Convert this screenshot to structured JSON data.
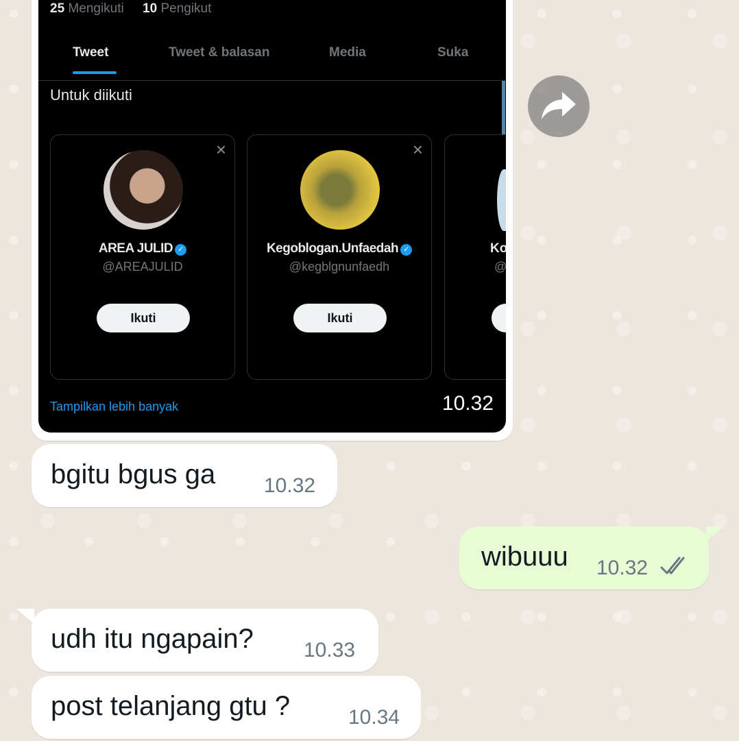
{
  "screenshot": {
    "stats": {
      "following_count": "25",
      "following_label": "Mengikuti",
      "followers_count": "10",
      "followers_label": "Pengikut"
    },
    "tabs": [
      {
        "label": "Tweet",
        "active": true
      },
      {
        "label": "Tweet & balasan",
        "active": false
      },
      {
        "label": "Media",
        "active": false
      },
      {
        "label": "Suka",
        "active": false
      }
    ],
    "section_title": "Untuk diikuti",
    "cards": [
      {
        "name": "AREA JULID",
        "handle": "@AREAJULID",
        "button": "Ikuti",
        "verified": true
      },
      {
        "name": "Kegoblogan.Unfaedah",
        "handle": "@kegblgnunfaedh",
        "button": "Ikuti",
        "verified": true
      },
      {
        "name": "Ko",
        "handle": "@"
      }
    ],
    "more_link": "Tampilkan lebih banyak",
    "verified_icon": "✓",
    "close_icon": "×"
  },
  "image_message": {
    "time": "10.32"
  },
  "messages": [
    {
      "direction": "in",
      "text": "bgitu bgus ga",
      "time": "10.32"
    },
    {
      "direction": "out",
      "text": "wibuuu",
      "time": "10.32",
      "status": "read"
    },
    {
      "direction": "in",
      "text": "udh itu ngapain?",
      "time": "10.33"
    },
    {
      "direction": "in",
      "text": "post telanjang gtu ?",
      "time": "10.34"
    }
  ],
  "colors": {
    "incoming_bubble": "#ffffff",
    "outgoing_bubble": "#e7fcd5",
    "read_ticks": "#667781",
    "twitter_blue": "#1d9bf0"
  },
  "icons": {
    "forward": "forward-arrow-icon",
    "read_status": "double-check-icon"
  }
}
